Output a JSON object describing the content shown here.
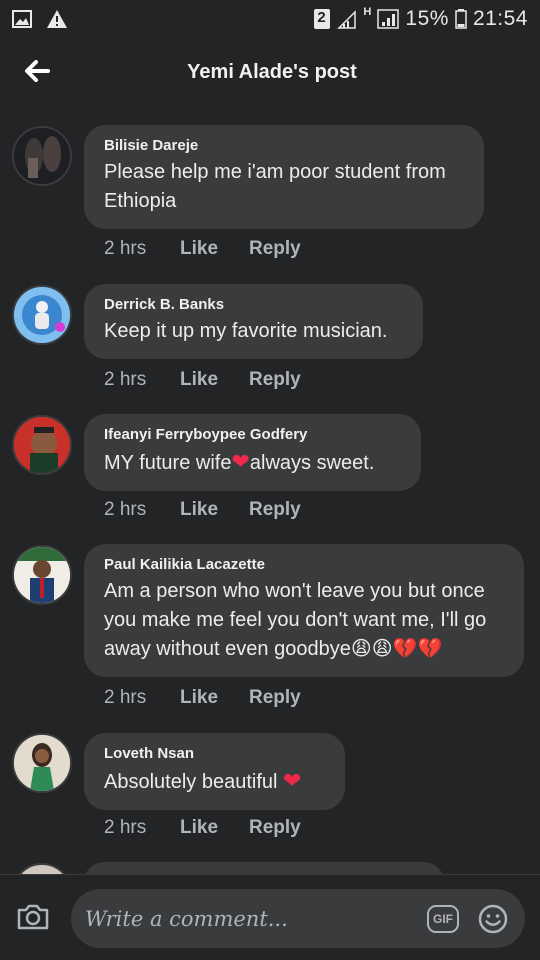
{
  "status_bar": {
    "sim_number": "2",
    "network_type": "H",
    "battery_percent": "15%",
    "time": "21:54",
    "icons": [
      "image-icon",
      "warning-icon",
      "sim-icon",
      "signal-icon",
      "signal-h-icon",
      "battery-icon"
    ]
  },
  "header": {
    "title": "Yemi Alade's post",
    "back_icon": "arrow-left-icon"
  },
  "comments": [
    {
      "author": "Bilisie Dareje",
      "text": "Please help me i'am poor student from Ethiopia",
      "time": "2 hrs",
      "like": "Like",
      "reply": "Reply"
    },
    {
      "author": "Derrick B. Banks",
      "text": "Keep it up my favorite musician.",
      "time": "2 hrs",
      "like": "Like",
      "reply": "Reply"
    },
    {
      "author": "Ifeanyi Ferryboypee Godfery",
      "text_before": "MY future wife",
      "text_after": "always sweet.",
      "time": "2 hrs",
      "like": "Like",
      "reply": "Reply"
    },
    {
      "author": "Paul Kailikia Lacazette",
      "text": "Am a person who won't leave you but once you make me feel you don't want me, I'll go away without even goodbye",
      "emojis": "😩😩💔💔",
      "time": "2 hrs",
      "like": "Like",
      "reply": "Reply"
    },
    {
      "author": "Loveth Nsan",
      "text": "Absolutely beautiful",
      "time": "2 hrs",
      "like": "Like",
      "reply": "Reply"
    }
  ],
  "composer": {
    "placeholder": "Write a comment...",
    "gif_label": "GIF"
  },
  "colors": {
    "background": "#232426",
    "bubble": "#3a3b3c",
    "muted_text": "#b0b3b8",
    "heart": "#f02849"
  }
}
